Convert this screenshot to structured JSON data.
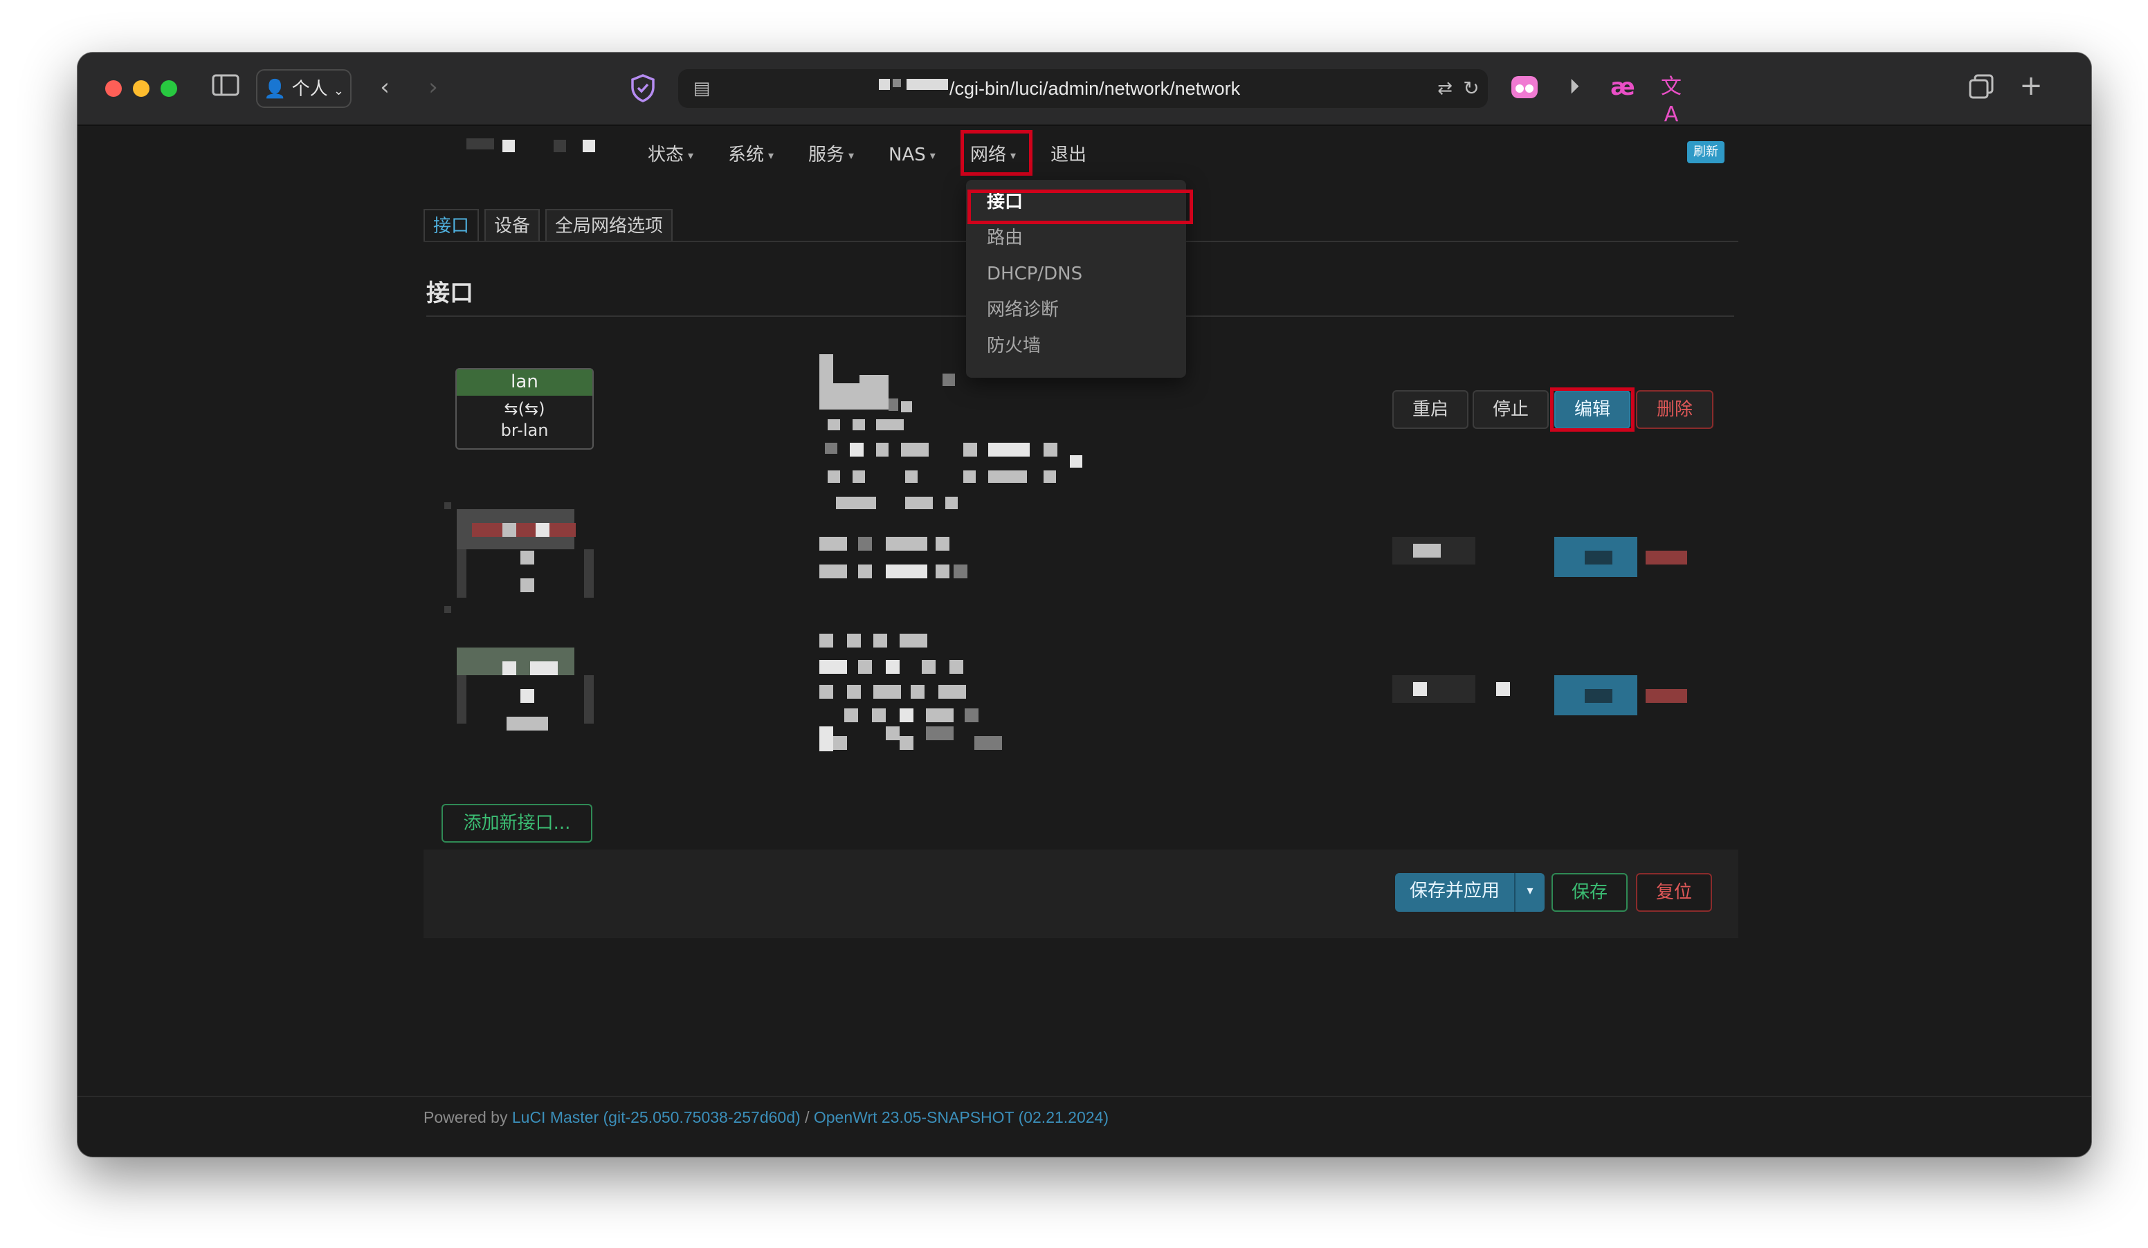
{
  "browser": {
    "profile_label": "个人",
    "url": "/cgi-bin/luci/admin/network/network"
  },
  "nav": {
    "items": [
      "状态",
      "系统",
      "服务",
      "NAS",
      "网络",
      "退出"
    ],
    "refresh_badge": "刷新"
  },
  "dropdown": {
    "items": [
      "接口",
      "路由",
      "DHCP/DNS",
      "网络诊断",
      "防火墙"
    ]
  },
  "tabs": [
    "接口",
    "设备",
    "全局网络选项"
  ],
  "section_title": "接口",
  "interfaces": [
    {
      "name": "lan",
      "icons": "⇆(⇆)",
      "device": "br-lan",
      "actions": [
        "重启",
        "停止",
        "编辑",
        "删除"
      ]
    }
  ],
  "add_button": "添加新接口...",
  "bottom_actions": {
    "save_apply": "保存并应用",
    "save": "保存",
    "reset": "复位"
  },
  "footer": {
    "powered_by": "Powered by ",
    "luci": "LuCI Master (git-25.050.75038-257d60d)",
    "sep": " / ",
    "openwrt": "OpenWrt 23.05-SNAPSHOT (02.21.2024)"
  },
  "colors": {
    "accent_blue": "#2a6f8e",
    "link_blue": "#3b8fba",
    "success_green": "#3bbd73",
    "danger_red": "#e05858",
    "annotation_red": "#d0021b",
    "iface_green": "#3d6b3a"
  }
}
